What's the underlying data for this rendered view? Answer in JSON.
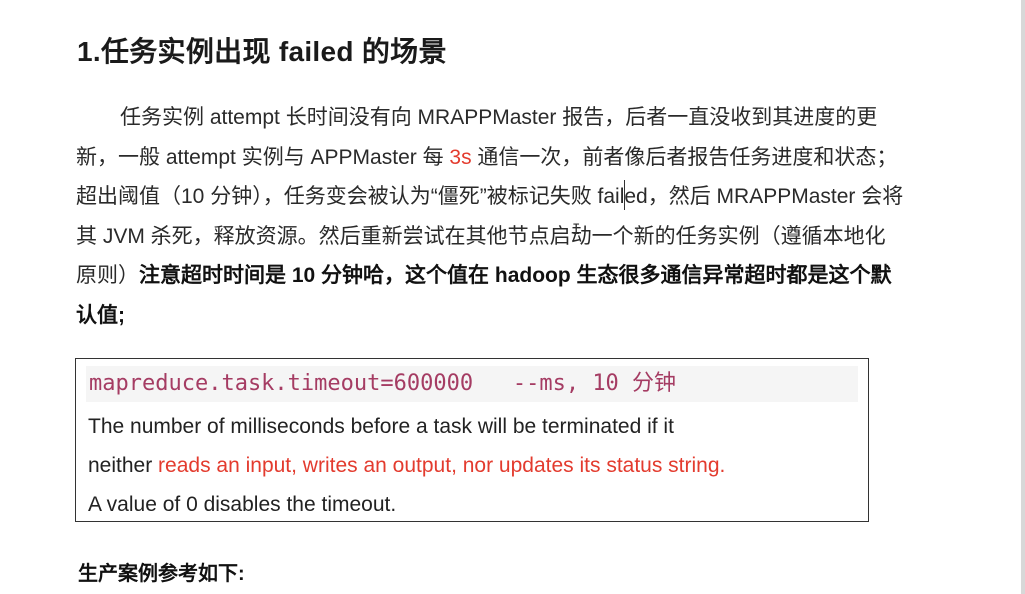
{
  "heading": "1.任务实例出现 failed 的场景",
  "paragraph": {
    "p1": "任务实例 attempt 长时间没有向 MRAPPMaster 报告，后者一直没收到其进度的更新，一般 attempt 实例与 APPMaster 每 ",
    "highlight_3s": "3s",
    "p2": " 通信一次，前者像后者报告任务进度和状态；超出阈值（10 分钟），任务变会被认为",
    "p3": "“僵死”被标记失败 failed，然后 MRAPPMaster 会将其 JVM 杀死，释放资源。然后重新尝试在其他节点启动一个新的任务实例（遵循本地化原则）",
    "bold_note": "注意超时时间是 10 分钟哈，这个值在 hadoop 生态很多通信异常超时都是这个默认值;"
  },
  "codebox": {
    "code": "mapreduce.task.timeout=600000   --ms, 10 分钟",
    "line1": "The number of milliseconds before a task will be terminated if it",
    "line2_prefix": "neither ",
    "line2_red": "reads an input, writes an output, nor updates its status string.",
    "line3": "A value of 0 disables the timeout."
  },
  "subheading": "生产案例参考如下:",
  "colors": {
    "highlight_red": "#e33b2e",
    "code_text": "#a53c63",
    "code_bg": "#f5f5f5"
  }
}
